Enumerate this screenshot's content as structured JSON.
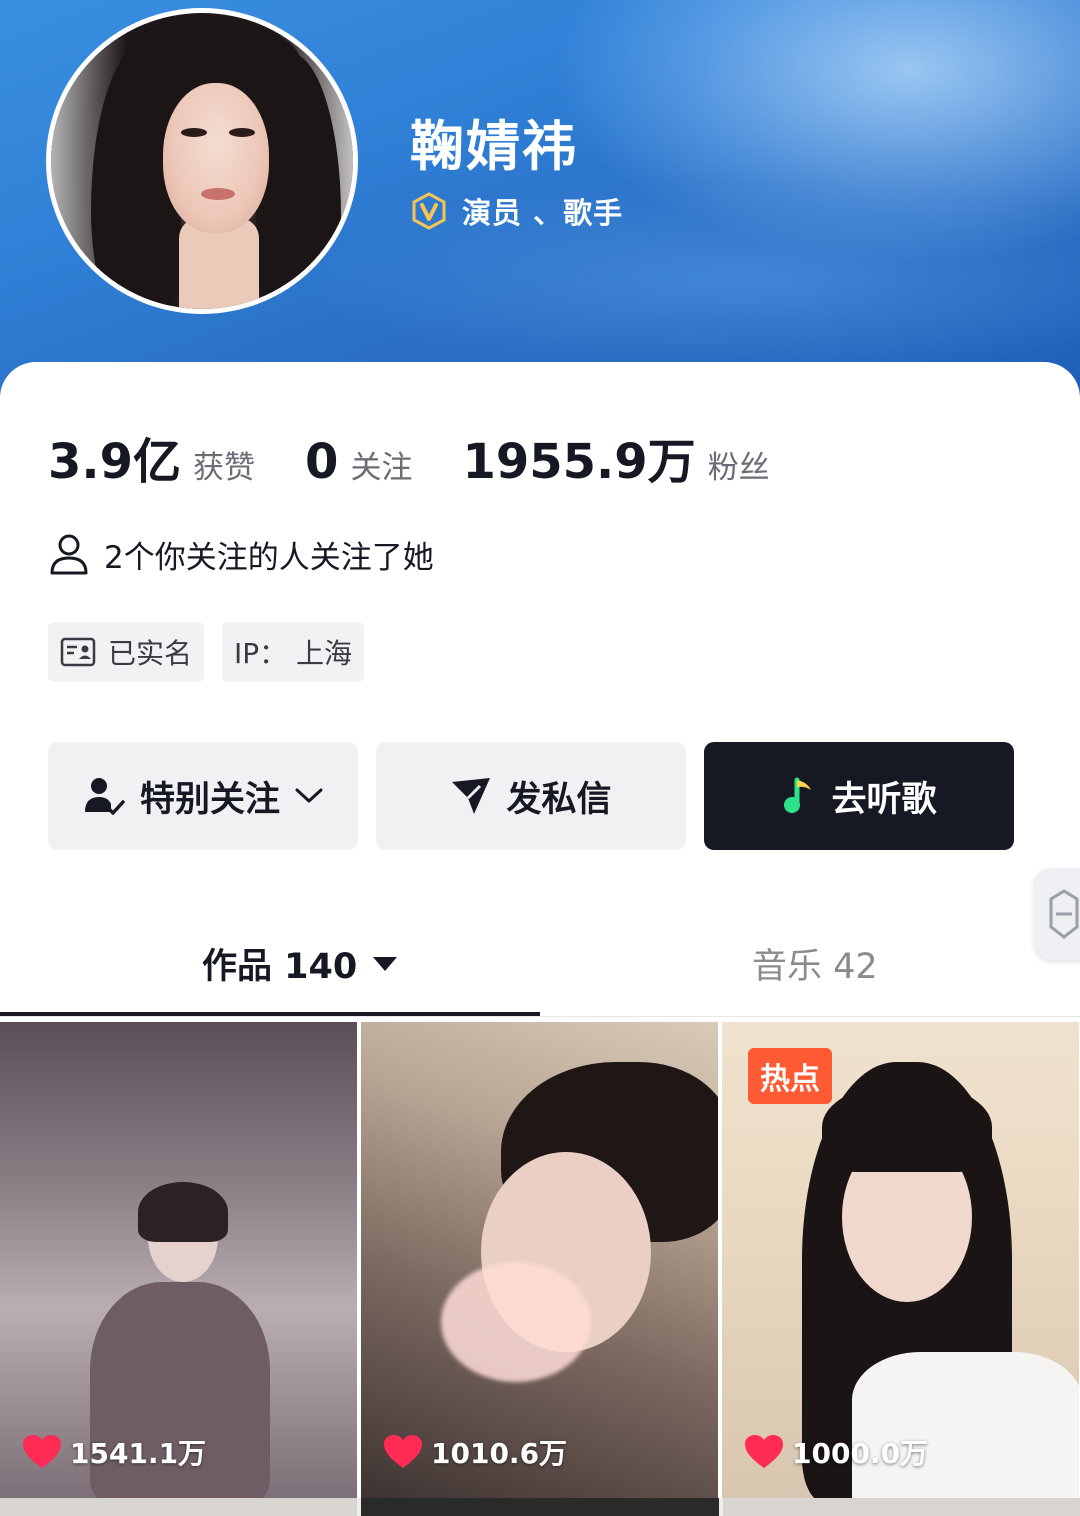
{
  "profile": {
    "name": "鞠婧祎",
    "verify_label": "演员 、歌手"
  },
  "stats": [
    {
      "value": "3.9亿",
      "label": "获赞"
    },
    {
      "value": "0",
      "label": "关注"
    },
    {
      "value": "1955.9万",
      "label": "粉丝"
    }
  ],
  "mutual_follow": "2个你关注的人关注了她",
  "tags": {
    "verified_name": "已实名",
    "ip_location": "IP：  上海"
  },
  "actions": {
    "follow_label": "特别关注",
    "message_label": "发私信",
    "music_label": "去听歌"
  },
  "tabs": {
    "works": "作品 140",
    "music": "音乐 42"
  },
  "videos": [
    {
      "likes": "1541.1万"
    },
    {
      "likes": "1010.6万"
    },
    {
      "likes": "1000.0万",
      "badge": "热点"
    }
  ],
  "colors": {
    "header_blue": "#2f7fd6",
    "dark_button": "#161823",
    "hot_badge": "#fe5a33",
    "heart": "#fe2c55",
    "verify_gold": "#f5c451"
  }
}
